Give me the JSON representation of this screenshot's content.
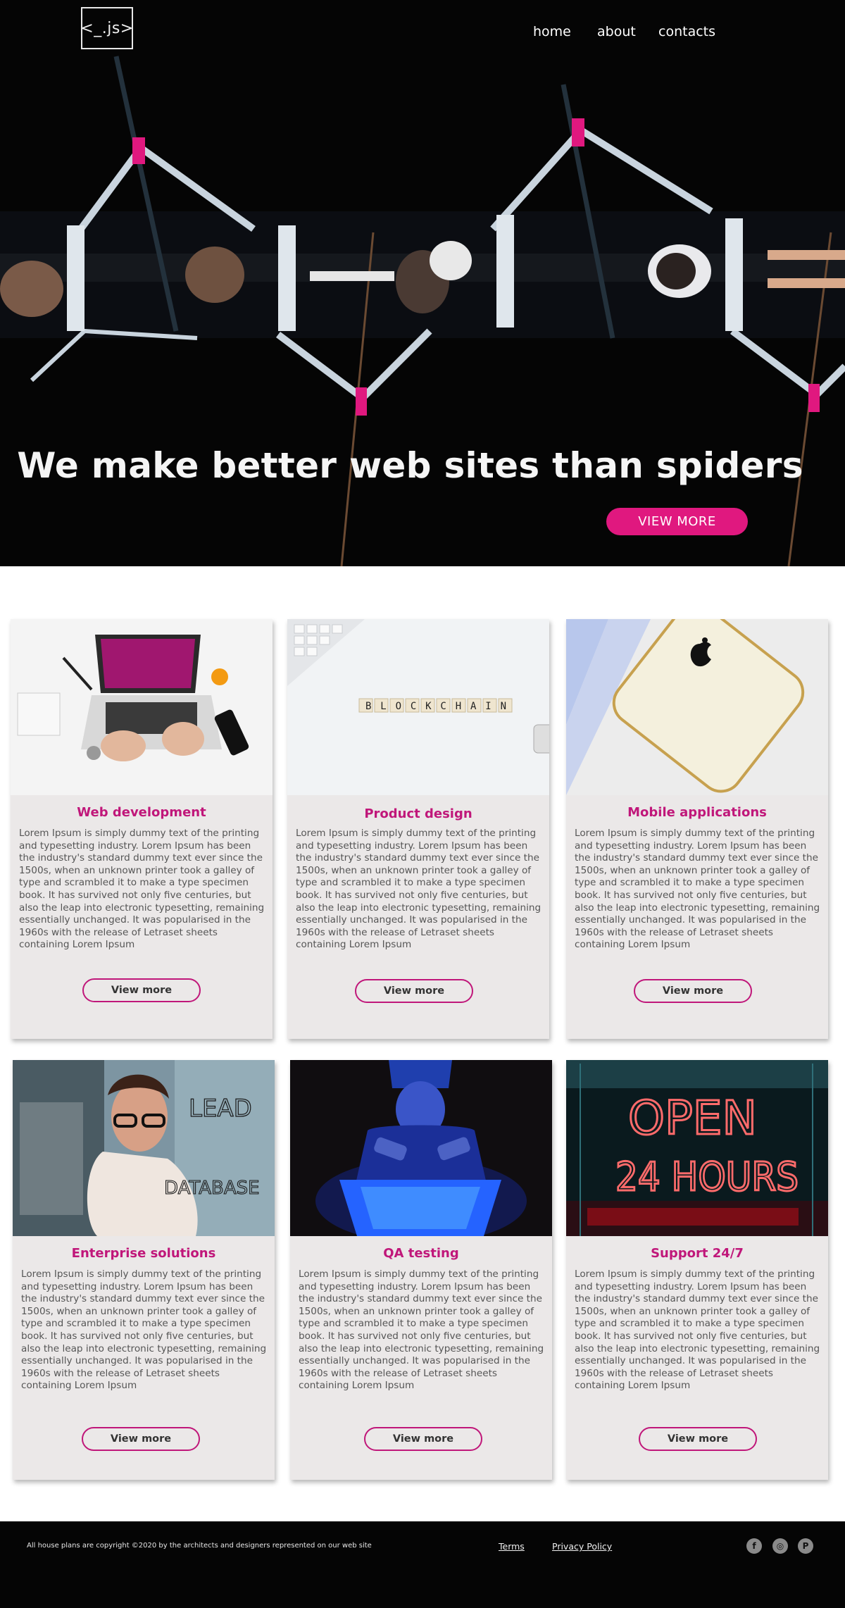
{
  "header": {
    "logo_text": "<_.js>",
    "nav": [
      "home",
      "about",
      "contacts"
    ]
  },
  "hero": {
    "title": "We make better web sites than spiders",
    "button": "VIEW MORE"
  },
  "cards": [
    {
      "title": "Web development",
      "text": "Lorem Ipsum is simply dummy text of the printing and typesetting industry. Lorem Ipsum has been the industry's standard dummy text ever since the 1500s, when an unknown printer took a galley of type and scrambled it to make a type specimen book. It has survived not only five centuries, but also the leap into electronic typesetting, remaining essentially unchanged. It was popularised in the 1960s with the release of Letraset sheets containing Lorem Ipsum",
      "button": "View more"
    },
    {
      "title": "Product design",
      "image_text": "BLOCKCHAIN",
      "text": "Lorem Ipsum is simply dummy text of the printing and typesetting industry. Lorem Ipsum has been the industry's standard dummy text ever since the 1500s, when an unknown printer took a galley of type and scrambled it to make a type specimen book. It has survived not only five centuries, but also the leap into electronic typesetting, remaining essentially unchanged. It was popularised in the 1960s with the release of Letraset sheets containing Lorem Ipsum",
      "button": "View more"
    },
    {
      "title": "Mobile applications",
      "text": "Lorem Ipsum is simply dummy text of the printing and typesetting industry. Lorem Ipsum has been the industry's standard dummy text ever since the 1500s, when an unknown printer took a galley of type and scrambled it to make a type specimen book. It has survived not only five centuries, but also the leap into electronic typesetting, remaining essentially unchanged. It was popularised in the 1960s with the release of Letraset sheets containing Lorem Ipsum",
      "button": "View more"
    },
    {
      "title": "Enterprise solutions",
      "image_text": [
        "LEAD",
        "DATABASE"
      ],
      "text": "Lorem Ipsum is simply dummy text of the printing and typesetting industry. Lorem Ipsum has been the industry's standard dummy text ever since the 1500s, when an unknown printer took a galley of type and scrambled it to make a type specimen book. It has survived not only five centuries, but also the leap into electronic typesetting, remaining essentially unchanged. It was popularised in the 1960s with the release of Letraset sheets containing Lorem Ipsum",
      "button": "View more"
    },
    {
      "title": "QA testing",
      "text": "Lorem Ipsum is simply dummy text of the printing and typesetting industry. Lorem Ipsum has been the industry's standard dummy text ever since the 1500s, when an unknown printer took a galley of type and scrambled it to make a type specimen book. It has survived not only five centuries, but also the leap into electronic typesetting, remaining essentially unchanged. It was popularised in the 1960s with the release of Letraset sheets containing Lorem Ipsum",
      "button": "View more"
    },
    {
      "title": "Support 24/7",
      "image_text": [
        "OPEN",
        "24 HOURS"
      ],
      "text": "Lorem Ipsum is simply dummy text of the printing and typesetting industry. Lorem Ipsum has been the industry's standard dummy text ever since the 1500s, when an unknown printer took a galley of type and scrambled it to make a type specimen book. It has survived not only five centuries, but also the leap into electronic typesetting, remaining essentially unchanged. It was popularised in the 1960s with the release of Letraset sheets containing Lorem Ipsum",
      "button": "View more"
    }
  ],
  "footer": {
    "copyright": "All house plans are copyright ©2020 by the architects and designers represented on our web site",
    "links": [
      "Terms",
      "Privacy Policy"
    ],
    "social": [
      {
        "icon": "facebook-icon",
        "glyph": "f"
      },
      {
        "icon": "instagram-icon",
        "glyph": "◎"
      },
      {
        "icon": "pinterest-icon",
        "glyph": "P"
      }
    ]
  },
  "colors": {
    "accent": "#e0187f",
    "title_accent": "#c0177a",
    "card_bg": "#ebe8e8",
    "hero_bg": "#050505",
    "footer_bg": "#050505"
  }
}
